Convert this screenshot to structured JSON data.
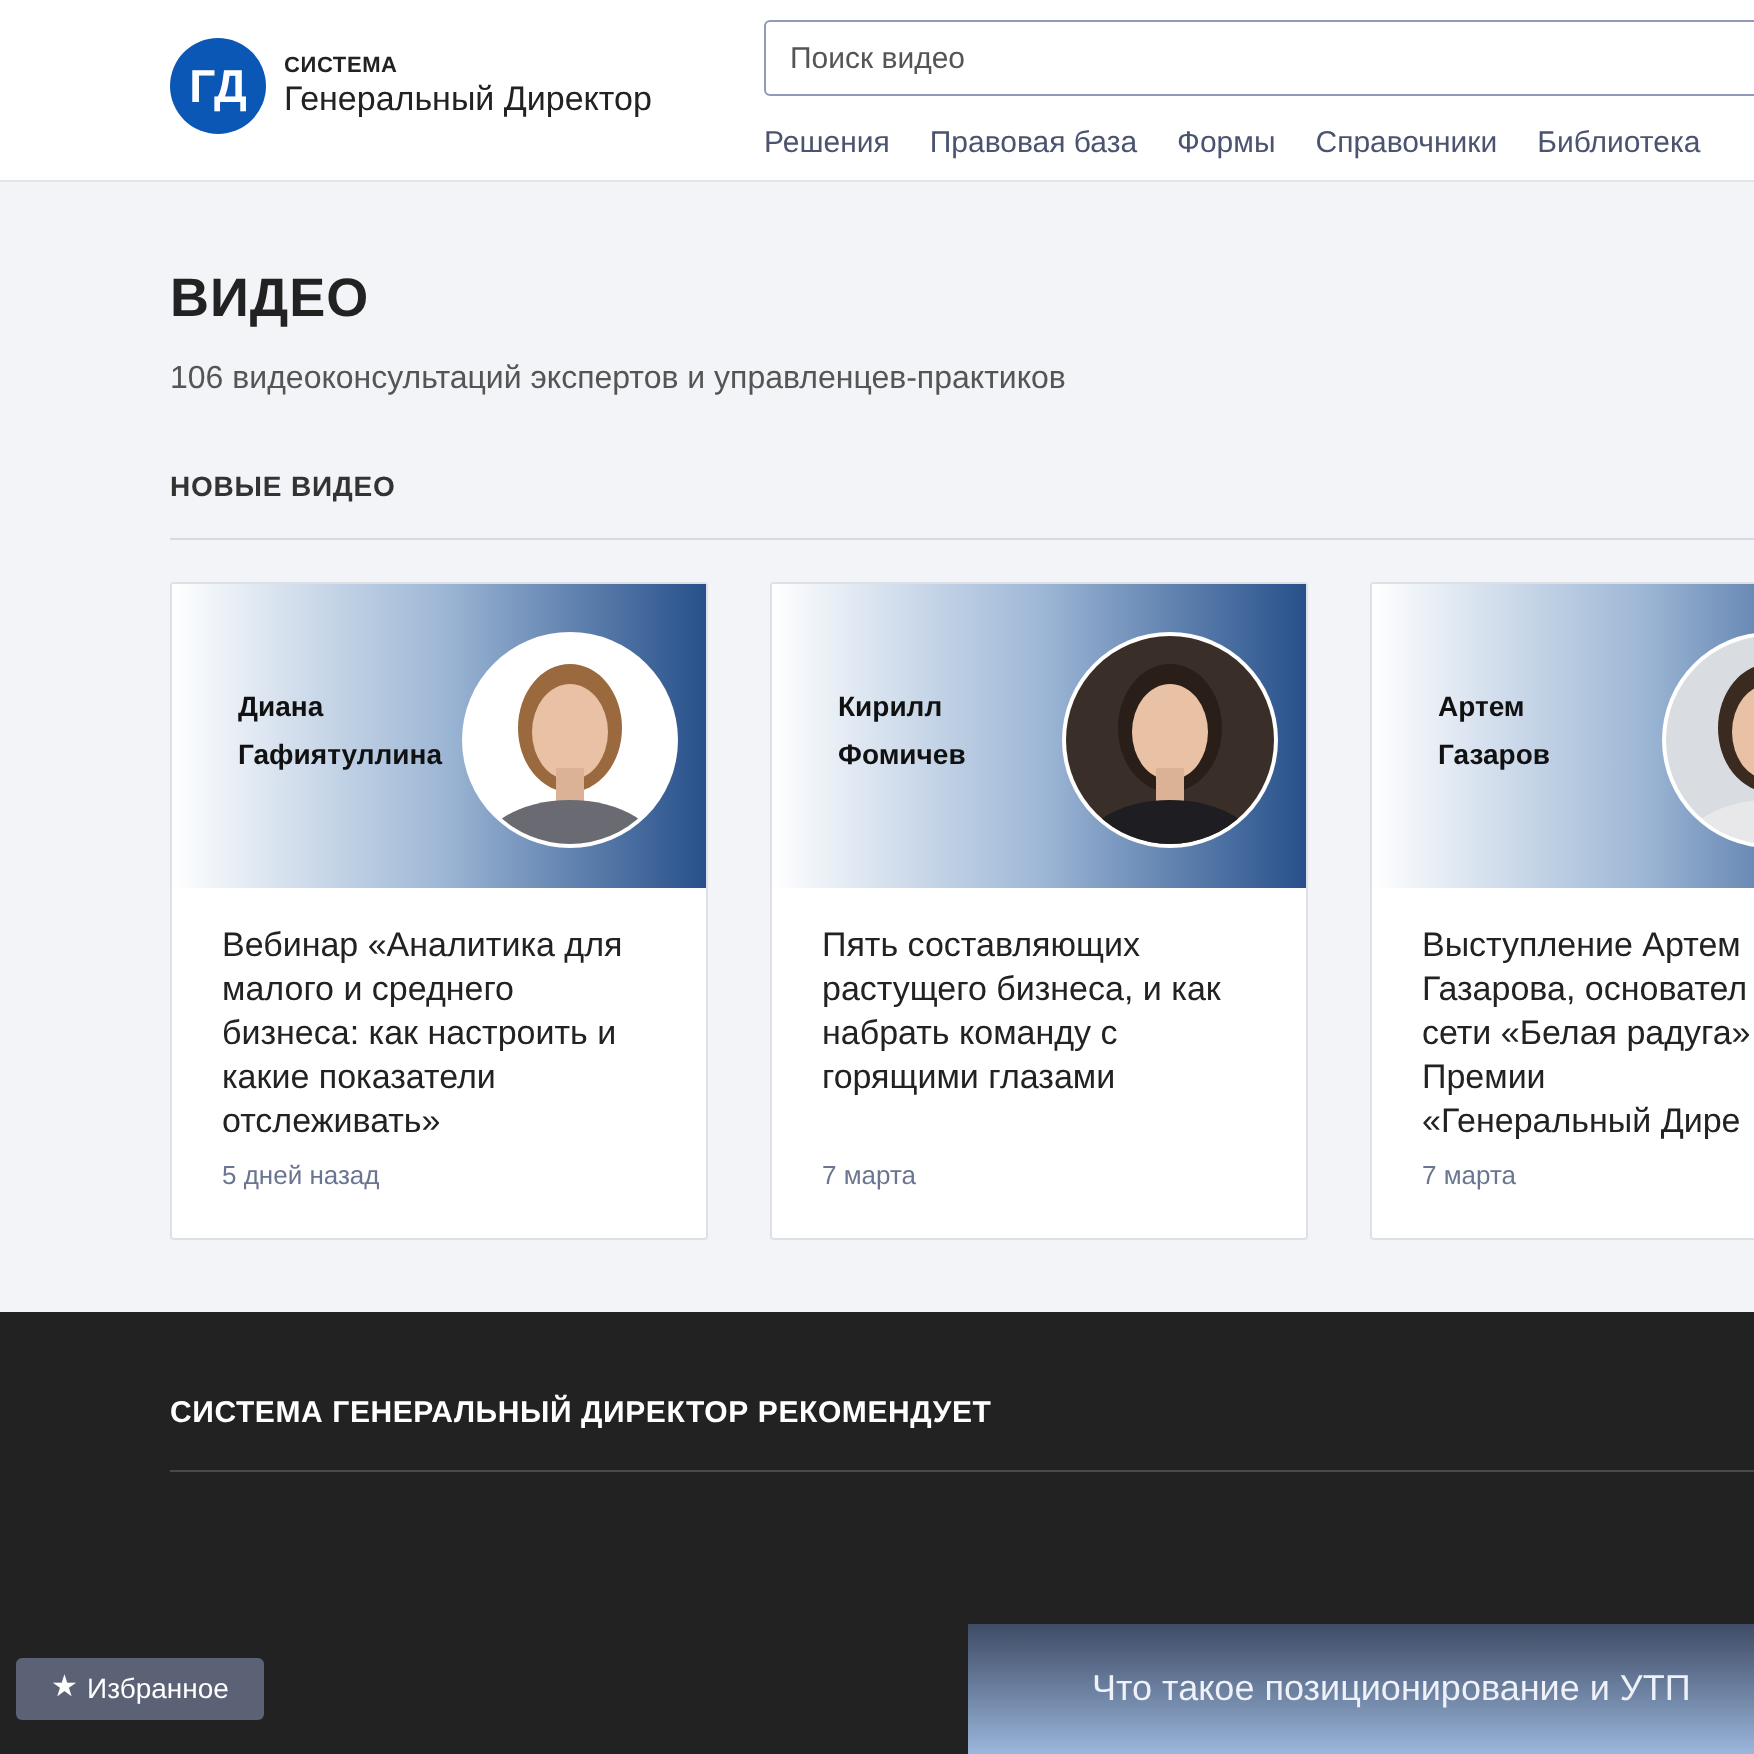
{
  "header": {
    "logo": {
      "mark": "ГД",
      "overline": "СИСТЕМА",
      "name": "Генеральный Директор"
    },
    "search": {
      "placeholder": "Поиск видео"
    },
    "nav": [
      "Решения",
      "Правовая база",
      "Формы",
      "Справочники",
      "Библиотека"
    ]
  },
  "page": {
    "title": "ВИДЕО",
    "subtitle": "106 видеоконсультаций экспертов и управленцев-практиков",
    "section": "НОВЫЕ ВИДЕО"
  },
  "videos": [
    {
      "speaker": "Диана\nГафиятуллина",
      "title": "Вебинар «Аналитика для малого и среднего бизнеса: как настроить и какие показатели отслеживать»",
      "date": "5 дней назад"
    },
    {
      "speaker": "Кирилл\nФомичев",
      "title": "Пять составляющих растущего бизнеса, и как набрать команду с горящими глазами",
      "date": "7 марта"
    },
    {
      "speaker": "Артем\nГазаров",
      "title": "Выступление Артем\nГазарова, основател\nсети «Белая радуга»\nПремии\n«Генеральный Дире",
      "date": "7 марта"
    }
  ],
  "recommend": {
    "title": "СИСТЕМА ГЕНЕРАЛЬНЫЙ ДИРЕКТОР РЕКОМЕНДУЕТ"
  },
  "favorites": {
    "icon": "★",
    "label": "Избранное"
  },
  "banner": {
    "title": "Что такое позиционирование и УТП"
  }
}
